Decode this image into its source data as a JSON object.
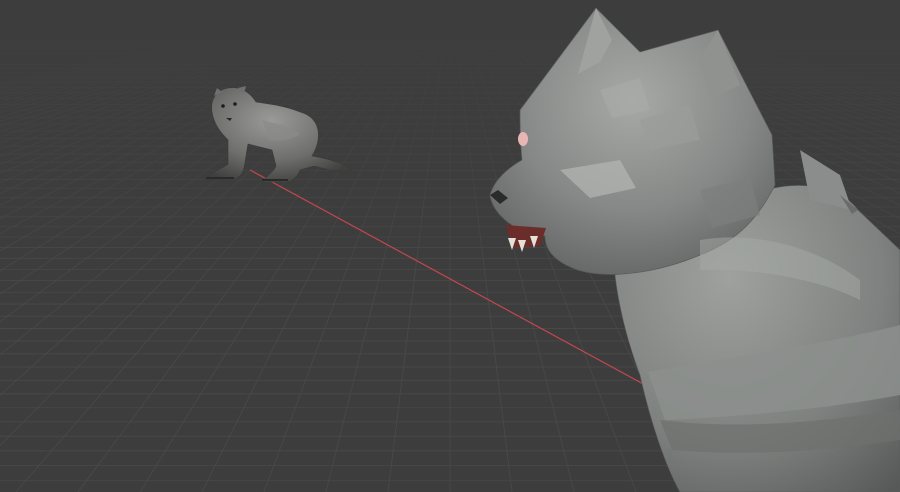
{
  "viewport": {
    "background_color": "#3d3d3d",
    "grid_line_color": "#4a4a4a",
    "x_axis_color": "#c2474f",
    "mode": "3d-viewport"
  },
  "objects": [
    {
      "name": "cat-model-distant",
      "pose": "crouching",
      "material": "gray-fur"
    },
    {
      "name": "cat-model-closeup",
      "pose": "sitting-head-turned",
      "material": "gray-fur-lowpoly"
    }
  ]
}
